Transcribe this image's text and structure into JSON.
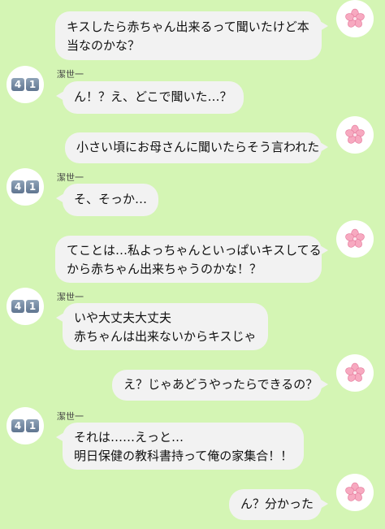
{
  "theme": {
    "background": "#d4f5b4",
    "bubble": "#f2f2f2"
  },
  "friend": {
    "name": "潔世一",
    "avatar_icon": "number-41-emoji-icon",
    "avatar_digits": [
      "4",
      "1"
    ]
  },
  "me": {
    "avatar_icon": "cherry-blossom-icon"
  },
  "messages": [
    {
      "from": "me",
      "lines": [
        "キスしたら赤ちゃん出来るって聞いたけど本",
        "当なのかな？"
      ]
    },
    {
      "from": "friend",
      "sender": "潔世一",
      "lines": [
        "ん！？え、どこで聞いた…？"
      ]
    },
    {
      "from": "me",
      "lines": [
        "小さい頃にお母さんに聞いたらそう言われた"
      ]
    },
    {
      "from": "friend",
      "sender": "潔世一",
      "lines": [
        "そ、そっか…"
      ]
    },
    {
      "from": "me",
      "lines": [
        "てことは…私よっちゃんといっぱいキスしてる",
        "から赤ちゃん出来ちゃうのかな！？"
      ]
    },
    {
      "from": "friend",
      "sender": "潔世一",
      "lines": [
        "いや大丈夫大丈夫",
        "赤ちゃんは出来ないからキスじゃ"
      ]
    },
    {
      "from": "me",
      "lines": [
        "え？じゃあどうやったらできるの？"
      ]
    },
    {
      "from": "friend",
      "sender": "潔世一",
      "lines": [
        "それは……えっと…",
        "明日保健の教科書持って俺の家集合！！"
      ]
    },
    {
      "from": "me",
      "lines": [
        "ん？分かった"
      ]
    }
  ]
}
